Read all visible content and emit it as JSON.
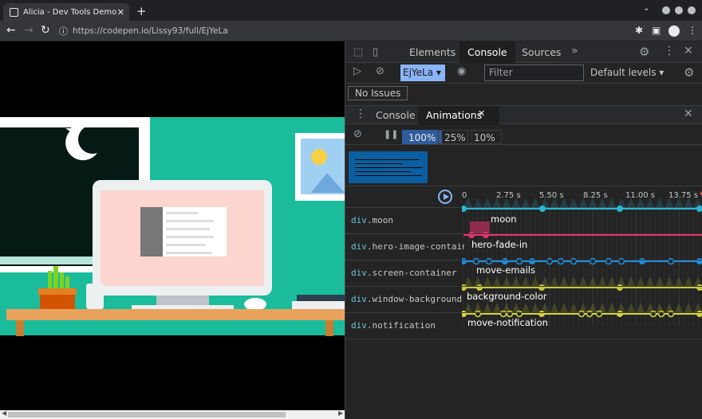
{
  "browser": {
    "tab_title": "Alicia - Dev Tools Demo Anim",
    "new_tab": "+",
    "url": "https://codepen.io/Lissy93/full/EjYeLa"
  },
  "devtools": {
    "top_tabs": [
      "Elements",
      "Console",
      "Sources"
    ],
    "active_top_tab": "Console",
    "more_tabs": "»",
    "context": "EjYeLa",
    "filter_placeholder": "Filter",
    "levels": "Default levels",
    "issues": "No Issues",
    "drawer_tabs": [
      "Console",
      "Animations"
    ],
    "active_drawer_tab": "Animations",
    "speeds": [
      "100%",
      "25%",
      "10%"
    ],
    "active_speed": "100%",
    "ticks": [
      "0",
      "2.75 s",
      "5.50 s",
      "8.25 s",
      "11.00 s",
      "13.75 s"
    ],
    "animations": [
      {
        "selector_tag": "div",
        "selector_class": ".moon",
        "name": "moon",
        "color": "#29b6d8"
      },
      {
        "selector_tag": "div",
        "selector_class": ".hero-image-contain",
        "name": "hero-fade-in",
        "color": "#e8336c"
      },
      {
        "selector_tag": "div",
        "selector_class": ".screen-container",
        "name": "move-emails",
        "color": "#1a8fe0"
      },
      {
        "selector_tag": "div",
        "selector_class": ".window-background",
        "name": "background-color",
        "color": "#c4c93a"
      },
      {
        "selector_tag": "div",
        "selector_class": ".notification",
        "name": "move-notification",
        "color": "#d4d43a"
      }
    ]
  },
  "icons": {
    "back": "arrow-left",
    "forward": "arrow-right",
    "reload": "reload",
    "lock": "info",
    "extensions": "puzzle",
    "settings": "gear",
    "close": "x"
  }
}
